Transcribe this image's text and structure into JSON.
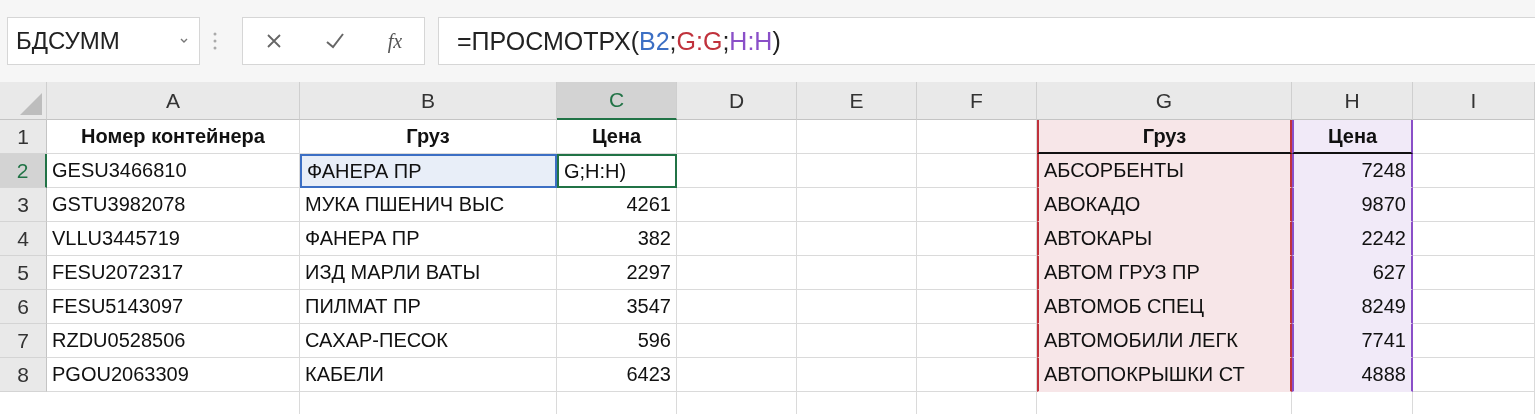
{
  "name_box": {
    "value": "БДСУММ"
  },
  "formula_bar": {
    "function_label": "fx",
    "formula": [
      {
        "text": "=ПРОСМОТРХ("
      },
      {
        "text": "B2",
        "color": "#3c6fc4"
      },
      {
        "text": ";"
      },
      {
        "text": "G:G",
        "color": "#c0323c"
      },
      {
        "text": ";"
      },
      {
        "text": "H:H",
        "color": "#8a4fc8"
      },
      {
        "text": ")"
      }
    ]
  },
  "columns": [
    {
      "label": "A",
      "selected": false
    },
    {
      "label": "B",
      "selected": false
    },
    {
      "label": "C",
      "selected": true
    },
    {
      "label": "D",
      "selected": false
    },
    {
      "label": "E",
      "selected": false
    },
    {
      "label": "F",
      "selected": false
    },
    {
      "label": "G",
      "selected": false,
      "color": "#c0323c"
    },
    {
      "label": "H",
      "selected": false,
      "color": "#8a4fc8"
    },
    {
      "label": "I",
      "selected": false
    }
  ],
  "rows": [
    {
      "number": "1",
      "selected": false,
      "kind": "header",
      "cells": {
        "A": "Номер контейнера",
        "B": "Груз",
        "C": "Цена",
        "G": "Груз",
        "H": "Цена"
      }
    },
    {
      "number": "2",
      "selected": true,
      "kind": "data",
      "cells": {
        "A": "GESU3466810",
        "B": {
          "text": "ФАНЕРА ПР",
          "color": "#3c6fc4"
        },
        "C": {
          "text": "G;H:H)",
          "editing": true
        },
        "G": "АБСОРБЕНТЫ",
        "H": "7248"
      }
    },
    {
      "number": "3",
      "selected": false,
      "kind": "data",
      "cells": {
        "A": "GSTU3982078",
        "B": "МУКА ПШЕНИЧ ВЫС",
        "C": "4261",
        "G": "АВОКАДО",
        "H": "9870"
      }
    },
    {
      "number": "4",
      "selected": false,
      "kind": "data",
      "cells": {
        "A": "VLLU3445719",
        "B": "ФАНЕРА ПР",
        "C": "382",
        "G": "АВТОКАРЫ",
        "H": "2242"
      }
    },
    {
      "number": "5",
      "selected": false,
      "kind": "data",
      "cells": {
        "A": "FESU2072317",
        "B": "ИЗД МАРЛИ ВАТЫ",
        "C": "2297",
        "G": "АВТОМ ГРУЗ ПР",
        "H": "627"
      }
    },
    {
      "number": "6",
      "selected": false,
      "kind": "data",
      "cells": {
        "A": "FESU5143097",
        "B": "ПИЛМАТ ПР",
        "C": "3547",
        "G": "АВТОМОБ СПЕЦ",
        "H": "8249"
      }
    },
    {
      "number": "7",
      "selected": false,
      "kind": "data",
      "cells": {
        "A": "RZDU0528506",
        "B": "САХАР-ПЕСОК",
        "C": "596",
        "G": "АВТОМОБИЛИ ЛЕГК",
        "H": "7741"
      }
    },
    {
      "number": "8",
      "selected": false,
      "kind": "data",
      "cells": {
        "A": "PGOU2063309",
        "B": "КАБЕЛИ",
        "C": "6423",
        "G": "АВТОПОКРЫШКИ СТ",
        "H": "4888"
      }
    }
  ]
}
